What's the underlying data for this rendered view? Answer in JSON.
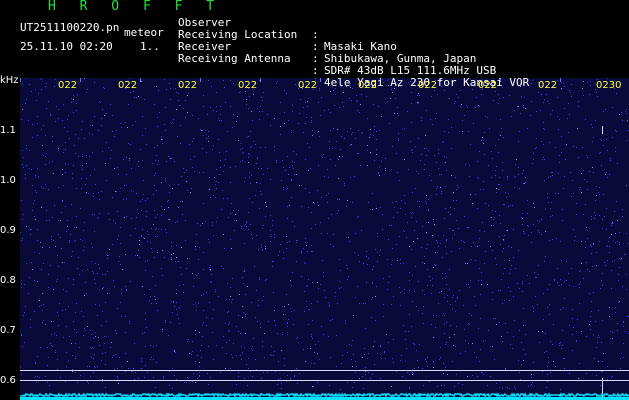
{
  "header": {
    "app_title": "H R O F F T",
    "filename": "UT2511100220.pn",
    "meteor_label": "meteor",
    "datetime": "25.11.10 02:20",
    "count": "1..",
    "info": [
      {
        "label": "Observer",
        "sep": ":",
        "value": "Masaki Kano"
      },
      {
        "label": "Receiving Location",
        "sep": ":",
        "value": "Shibukawa, Gunma, Japan"
      },
      {
        "label": "Receiver",
        "sep": ":",
        "value": "SDR# 43dB L15 111.6MHz USB"
      },
      {
        "label": "Receiving Antenna",
        "sep": ":",
        "value": "4ele Yagi Az 230 for Kansai VOR"
      }
    ]
  },
  "axes": {
    "unit": "kHz",
    "y_ticks": [
      "1.1",
      "1.0",
      "0.9",
      "0.8",
      "0.7",
      "0.6"
    ],
    "x_ticks": [
      "022",
      "022",
      "022",
      "022",
      "022",
      "022",
      "022",
      "022",
      "022",
      "0230"
    ]
  },
  "colors": {
    "background": "#000000",
    "spectrum_base": "#0a0a3a",
    "noise_dot": "#3a3aff",
    "title_green": "#22e03a",
    "tick_yellow": "#ffff40",
    "trace_cyan": "#00e5ff",
    "grid_line": "#d8d8ff"
  }
}
